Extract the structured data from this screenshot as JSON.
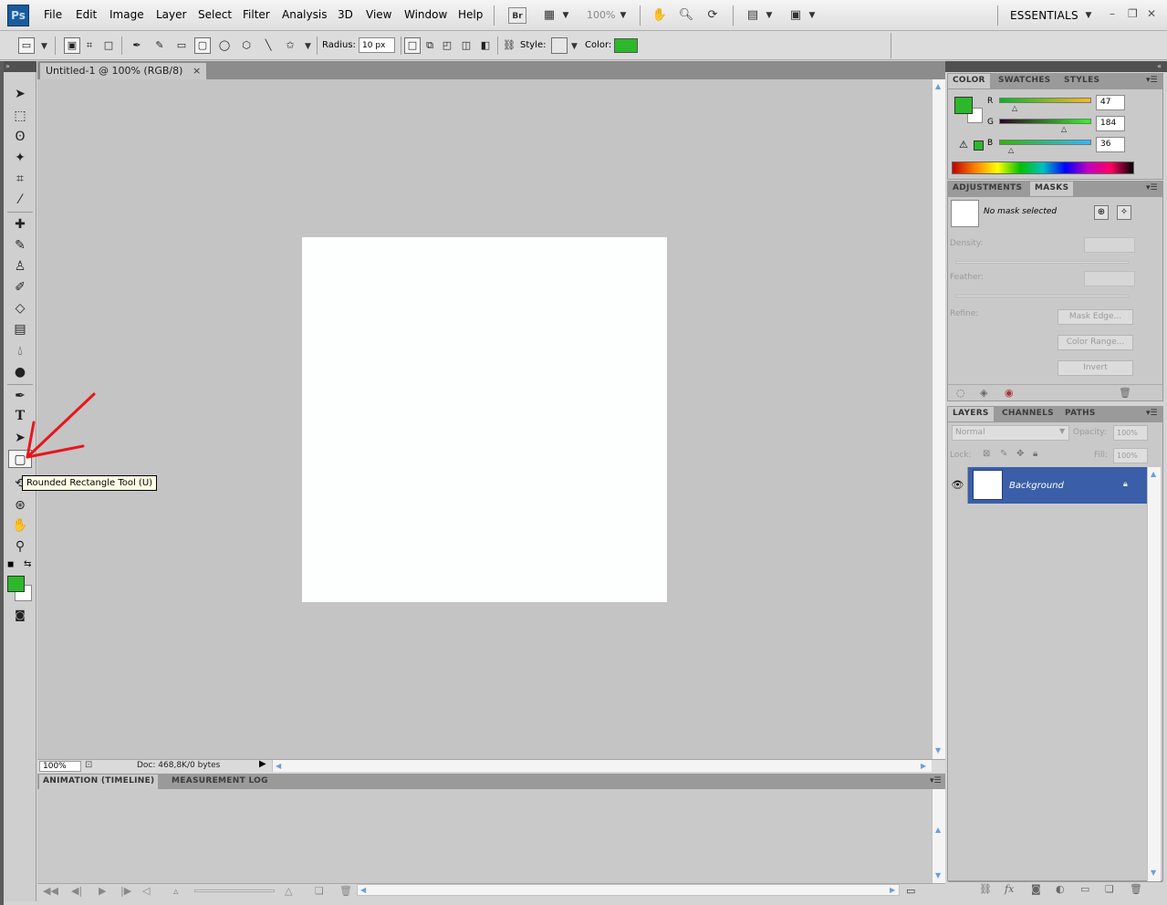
{
  "app": {
    "logo": "Ps"
  },
  "menu": [
    "File",
    "Edit",
    "Image",
    "Layer",
    "Select",
    "Filter",
    "Analysis",
    "3D",
    "View",
    "Window",
    "Help"
  ],
  "menubar": {
    "bridge_label": "Br",
    "zoom": "100%",
    "workspace": "ESSENTIALS"
  },
  "options": {
    "radius_label": "Radius:",
    "radius_value": "10 px",
    "style_label": "Style:",
    "color_label": "Color:",
    "color_hex": "#2db82b"
  },
  "document": {
    "tab_title": "Untitled-1 @ 100% (RGB/8)",
    "close_glyph": "×",
    "status_zoom": "100%",
    "status_doc": "Doc: 468,8K/0 bytes"
  },
  "tooltip": "Rounded Rectangle Tool (U)",
  "bottom_panel": {
    "tabs": [
      "ANIMATION (TIMELINE)",
      "MEASUREMENT LOG"
    ]
  },
  "color_panel": {
    "tabs": [
      "COLOR",
      "SWATCHES",
      "STYLES"
    ],
    "fg_hex": "#2db82b",
    "channels": [
      {
        "label": "R",
        "value": "47"
      },
      {
        "label": "G",
        "value": "184"
      },
      {
        "label": "B",
        "value": "36"
      }
    ]
  },
  "masks_panel": {
    "tabs": [
      "ADJUSTMENTS",
      "MASKS"
    ],
    "no_mask": "No mask selected",
    "density_label": "Density:",
    "feather_label": "Feather:",
    "refine_label": "Refine:",
    "buttons": [
      "Mask Edge...",
      "Color Range...",
      "Invert"
    ]
  },
  "layers_panel": {
    "tabs": [
      "LAYERS",
      "CHANNELS",
      "PATHS"
    ],
    "blend_mode": "Normal",
    "opacity_label": "Opacity:",
    "opacity_value": "100%",
    "lock_label": "Lock:",
    "fill_label": "Fill:",
    "fill_value": "100%",
    "layer_name": "Background"
  },
  "icons": {
    "toolbox": [
      "move-icon",
      "marquee-icon",
      "lasso-icon",
      "magic-wand-icon",
      "crop-icon",
      "eyedropper-icon",
      "healing-brush-icon",
      "brush-icon",
      "clone-stamp-icon",
      "history-brush-icon",
      "eraser-icon",
      "gradient-icon",
      "blur-icon",
      "dodge-icon",
      "pen-icon",
      "type-icon",
      "path-selection-icon",
      "rounded-rectangle-icon",
      "3d-rotate-icon",
      "3d-orbit-icon",
      "hand-icon",
      "zoom-icon"
    ]
  }
}
